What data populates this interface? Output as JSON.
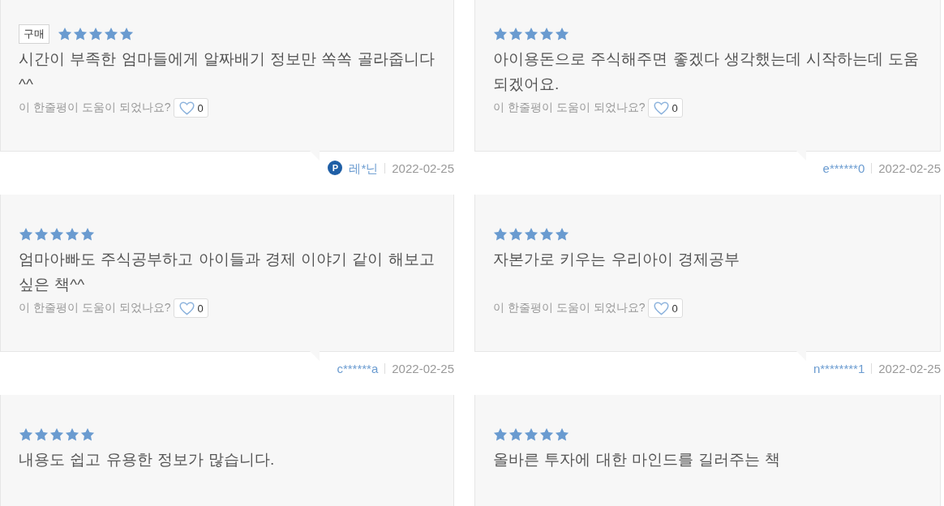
{
  "reviews": [
    {
      "purchase_badge": "구매",
      "stars": 5,
      "text": "시간이 부족한 엄마들에게 알짜배기 정보만 쏙쏙 골라줍니다^^",
      "helpful": {
        "question": "이 한줄평이 도움이 되었나요?",
        "count": "0"
      },
      "author": {
        "badge": "P",
        "name": "레*닌"
      },
      "date": "2022-02-25"
    },
    {
      "stars": 5,
      "text": "아이용돈으로 주식해주면 좋겠다 생각했는데 시작하는데 도움되겠어요.",
      "helpful": {
        "question": "이 한줄평이 도움이 되었나요?",
        "count": "0"
      },
      "author": {
        "name": "e******0"
      },
      "date": "2022-02-25"
    },
    {
      "stars": 5,
      "text": "엄마아빠도 주식공부하고 아이들과 경제 이야기 같이 해보고 싶은 책^^",
      "helpful": {
        "question": "이 한줄평이 도움이 되었나요?",
        "count": "0"
      },
      "author": {
        "name": "c******a"
      },
      "date": "2022-02-25"
    },
    {
      "stars": 5,
      "text": "자본가로 키우는 우리아이 경제공부",
      "helpful": {
        "question": "이 한줄평이 도움이 되었나요?",
        "count": "0"
      },
      "author": {
        "name": "n********1"
      },
      "date": "2022-02-25"
    },
    {
      "stars": 5,
      "text": "내용도 쉽고 유용한 정보가 많습니다."
    },
    {
      "stars": 5,
      "text": "올바른 투자에 대한 마인드를 길러주는 책"
    }
  ]
}
